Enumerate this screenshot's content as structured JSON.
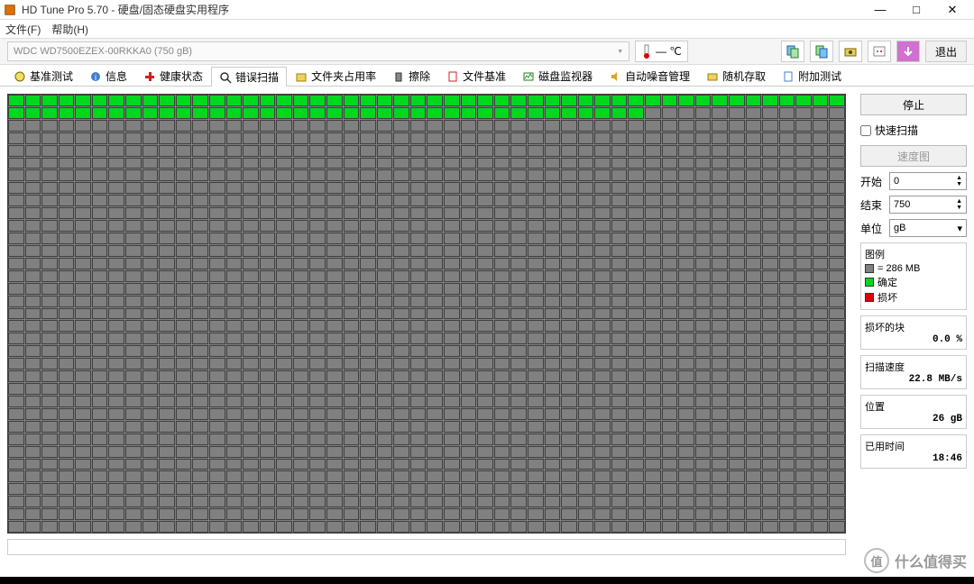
{
  "window": {
    "title": "HD Tune Pro 5.70 - 硬盘/固态硬盘实用程序",
    "min": "—",
    "max": "□",
    "close": "✕"
  },
  "menu": {
    "file": "文件(F)",
    "help": "帮助(H)"
  },
  "toolbar": {
    "drive": "WDC WD7500EZEX-00RKKA0 (750 gB)",
    "temp": "— ℃",
    "exit": "退出"
  },
  "tabs": {
    "benchmark": "基准测试",
    "info": "信息",
    "health": "健康状态",
    "error_scan": "错误扫描",
    "folder_usage": "文件夹占用率",
    "erase": "擦除",
    "file_bench": "文件基准",
    "disk_monitor": "磁盘监视器",
    "aam": "自动噪音管理",
    "random": "随机存取",
    "extra": "附加测试"
  },
  "panel": {
    "stop": "停止",
    "quick_scan": "快速扫描",
    "speed_map": "速度图",
    "start": "开始",
    "start_val": "0",
    "end": "结束",
    "end_val": "750",
    "unit": "单位",
    "unit_val": "gB"
  },
  "legend": {
    "title": "图例",
    "block_size": "= 286 MB",
    "ok": "确定",
    "damaged": "损坏"
  },
  "stats": {
    "damaged_blocks": "损坏的块",
    "damaged_val": "0.0 %",
    "scan_speed": "扫描速度",
    "speed_val": "22.8 MB/s",
    "position": "位置",
    "position_val": "26 gB",
    "elapsed": "已用时间",
    "elapsed_val": "18:46"
  },
  "scan": {
    "cols": 50,
    "rows": 35,
    "full_ok_rows": 1,
    "partial_ok_row_cols": 38
  },
  "watermark": {
    "icon": "值",
    "text": "什么值得买"
  }
}
